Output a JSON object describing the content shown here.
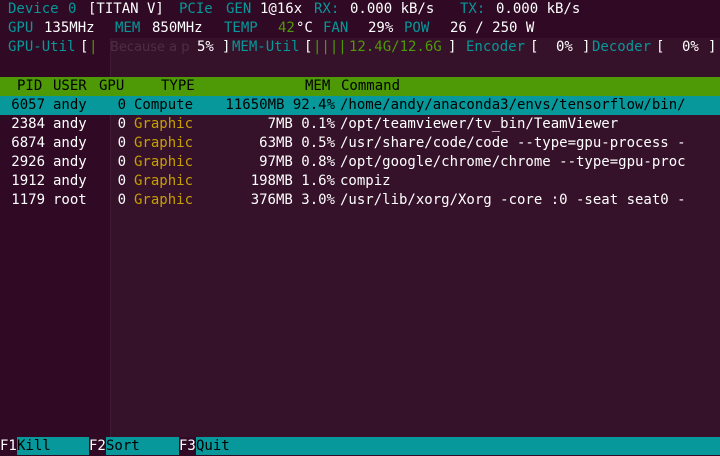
{
  "device": {
    "device_label": "Device",
    "device_index": "0",
    "device_name": "[TITAN V]",
    "pcie_label": "PCIe",
    "gen_label": "GEN",
    "gen_value": "1@16x",
    "rx_label": "RX:",
    "rx_value": "0.000 kB/s",
    "tx_label": "TX:",
    "tx_value": "0.000 kB/s"
  },
  "clocks": {
    "gpu_label": "GPU",
    "gpu_value": "135MHz",
    "mem_label": "MEM",
    "mem_value": "850MHz",
    "temp_label": "TEMP",
    "temp_value": "42",
    "temp_unit": "°C",
    "fan_label": "FAN",
    "fan_value": "29%",
    "pow_label": "POW",
    "pow_value": "26 / 250 W"
  },
  "util": {
    "gpu_util_label": "GPU-Util",
    "gpu_util_bar": "|",
    "gpu_util_value": "5%",
    "mem_util_label": "MEM-Util",
    "mem_util_bar": "||||",
    "mem_util_value": "12.4G/12.6G",
    "encoder_label": "Encoder",
    "encoder_value": "0%",
    "decoder_label": "Decoder",
    "decoder_value": "0%"
  },
  "ghost_window": {
    "title": "Because a p"
  },
  "table": {
    "headers": {
      "pid": "PID",
      "user": "USER",
      "gpu": "GPU",
      "type": "TYPE",
      "mem": "MEM",
      "command": "Command"
    },
    "rows": [
      {
        "pid": "6057",
        "user": "andy",
        "gpu": "0",
        "type": "Compute",
        "mem": "11650MB 92.4%",
        "command": "/home/andy/anaconda3/envs/tensorflow/bin/"
      },
      {
        "pid": "2384",
        "user": "andy",
        "gpu": "0",
        "type": "Graphic",
        "mem": "7MB 0.1%",
        "command": "/opt/teamviewer/tv_bin/TeamViewer"
      },
      {
        "pid": "6874",
        "user": "andy",
        "gpu": "0",
        "type": "Graphic",
        "mem": "63MB 0.5%",
        "command": "/usr/share/code/code --type=gpu-process -"
      },
      {
        "pid": "2926",
        "user": "andy",
        "gpu": "0",
        "type": "Graphic",
        "mem": "97MB 0.8%",
        "command": "/opt/google/chrome/chrome --type=gpu-proc"
      },
      {
        "pid": "1912",
        "user": "andy",
        "gpu": "0",
        "type": "Graphic",
        "mem": "198MB 1.6%",
        "command": "compiz"
      },
      {
        "pid": "1179",
        "user": "root",
        "gpu": "0",
        "type": "Graphic",
        "mem": "376MB 3.0%",
        "command": "/usr/lib/xorg/Xorg -core :0 -seat seat0 -"
      }
    ]
  },
  "footer": {
    "f1_key": "F1",
    "f1_label": "Kill",
    "f2_key": "F2",
    "f2_label": "Sort",
    "f3_key": "F3",
    "f3_label": "Quit"
  },
  "colors": {
    "background": "#300a24",
    "cyan": "#06989a",
    "green": "#4e9a06",
    "yellow": "#c4a000"
  }
}
